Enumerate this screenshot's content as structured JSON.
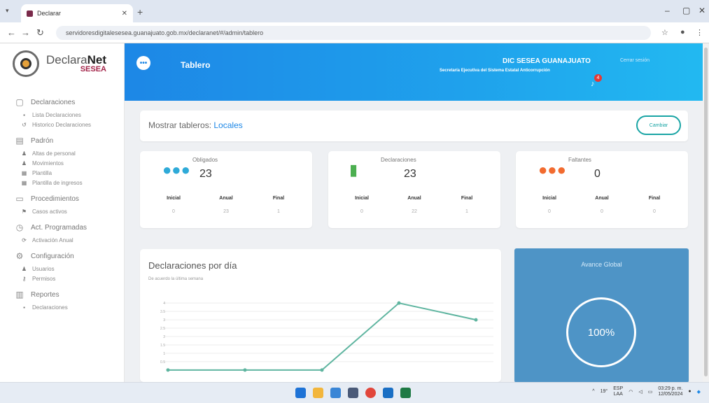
{
  "browser": {
    "tab_title": "Declarar",
    "url": "servidoresdigitalesesea.guanajuato.gob.mx/declaranet/#/admin/tablero"
  },
  "sidebar": {
    "logo_word_1": "Declara",
    "logo_word_2": "Net",
    "logo_sub": "SESEA",
    "sections": [
      {
        "label": "Declaraciones",
        "icon": "file-icon",
        "items": [
          {
            "label": "Lista Declaraciones",
            "icon": "list-icon"
          },
          {
            "label": "Historico Declaraciones",
            "icon": "history-icon"
          }
        ]
      },
      {
        "label": "Padrón",
        "icon": "clipboard-icon",
        "items": [
          {
            "label": "Altas de personal",
            "icon": "user-add-icon"
          },
          {
            "label": "Movimientos",
            "icon": "users-icon"
          },
          {
            "label": "Plantilla",
            "icon": "grid-icon"
          },
          {
            "label": "Plantilla de ingresos",
            "icon": "grid-icon"
          }
        ]
      },
      {
        "label": "Procedimientos",
        "icon": "folder-icon",
        "items": [
          {
            "label": "Casos activos",
            "icon": "case-icon"
          }
        ]
      },
      {
        "label": "Act. Programadas",
        "icon": "clock-icon",
        "items": [
          {
            "label": "Activación Anual",
            "icon": "refresh-icon"
          }
        ]
      },
      {
        "label": "Configuración",
        "icon": "gear-icon",
        "items": [
          {
            "label": "Usuarios",
            "icon": "users-icon"
          },
          {
            "label": "Permisos",
            "icon": "key-icon"
          }
        ]
      },
      {
        "label": "Reportes",
        "icon": "chart-icon",
        "items": [
          {
            "label": "Declaraciones",
            "icon": "list-icon"
          }
        ]
      }
    ]
  },
  "header": {
    "title": "Tablero",
    "user_name": "DIC SESEA GUANAJUATO",
    "user_org": "Secretaría Ejecutiva del Sistema Estatal Anticorrupción",
    "logout": "Cerrar sesión",
    "notification_count": "4"
  },
  "boards": {
    "label": "Mostrar tableros:",
    "value": "Locales",
    "change_button": "Cambiar"
  },
  "stats": [
    {
      "label": "Obligados",
      "value": "23",
      "icon": "people-icon",
      "color": "#2eaad8",
      "cols": [
        {
          "h": "Inicial",
          "v": "0"
        },
        {
          "h": "Anual",
          "v": "23"
        },
        {
          "h": "Final",
          "v": "1"
        }
      ]
    },
    {
      "label": "Declaraciones",
      "value": "23",
      "icon": "document-icon",
      "color": "#4caf50",
      "cols": [
        {
          "h": "Inicial",
          "v": "0"
        },
        {
          "h": "Anual",
          "v": "22"
        },
        {
          "h": "Final",
          "v": "1"
        }
      ]
    },
    {
      "label": "Faltantes",
      "value": "0",
      "icon": "people-icon",
      "color": "#f26b2f",
      "cols": [
        {
          "h": "Inicial",
          "v": "0"
        },
        {
          "h": "Anual",
          "v": "0"
        },
        {
          "h": "Final",
          "v": "0"
        }
      ]
    }
  ],
  "chart_card": {
    "title": "Declaraciones por día",
    "subtitle": "De acuerdo la última semana"
  },
  "chart_data": {
    "type": "line",
    "title": "Declaraciones por día",
    "x": [
      0,
      1,
      2,
      3,
      4
    ],
    "y": [
      0,
      0,
      0,
      4,
      3
    ],
    "yticks": [
      "4",
      "3.5",
      "3",
      "2.5",
      "2",
      "1.5",
      "1",
      "0.5"
    ],
    "ylim": [
      -0.3,
      4.3
    ],
    "grid": true,
    "series_color": "#5fb5a0"
  },
  "avance": {
    "title": "Avance Global",
    "percent": "100%"
  },
  "taskbar": {
    "temperature": "19°",
    "lang_top": "ESP",
    "lang_bottom": "LAA",
    "time": "03:29 p. m.",
    "date": "12/05/2024"
  }
}
